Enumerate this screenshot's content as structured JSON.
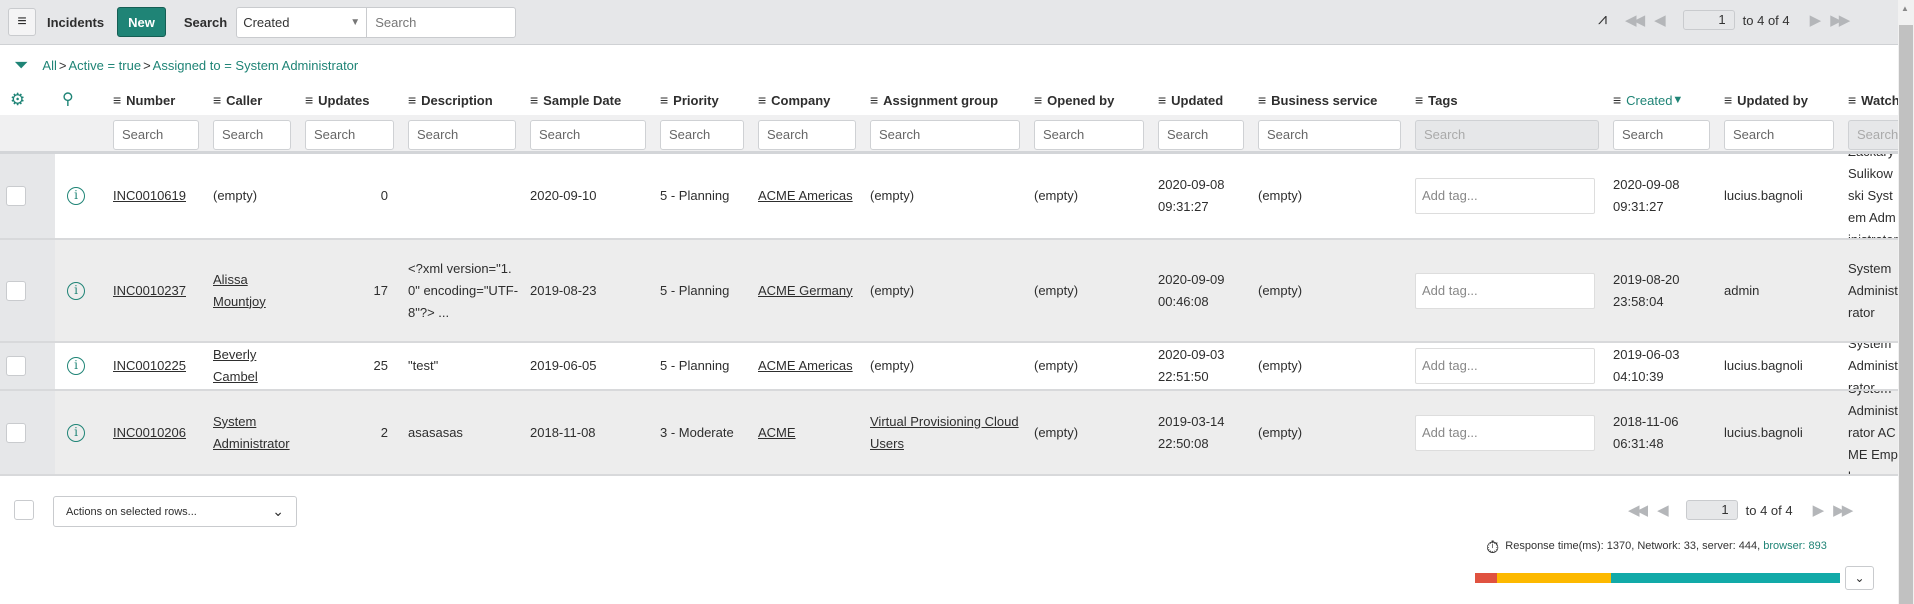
{
  "toolbar": {
    "title": "Incidents",
    "new_label": "New",
    "search_label": "Search",
    "search_field": "Created",
    "search_placeholder": "Search",
    "pager": {
      "page": "1",
      "range": "to 4 of 4"
    }
  },
  "breadcrumb": [
    "All",
    "Active = true",
    "Assigned to = System Administrator"
  ],
  "columns": [
    {
      "label": "Number",
      "search": "Search"
    },
    {
      "label": "Caller",
      "search": "Search"
    },
    {
      "label": "Updates",
      "search": "Search"
    },
    {
      "label": "Description",
      "search": "Search"
    },
    {
      "label": "Sample Date",
      "search": "Search"
    },
    {
      "label": "Priority",
      "search": "Search"
    },
    {
      "label": "Company",
      "search": "Search"
    },
    {
      "label": "Assignment group",
      "search": "Search"
    },
    {
      "label": "Opened by",
      "search": "Search"
    },
    {
      "label": "Updated",
      "search": "Search"
    },
    {
      "label": "Business service",
      "search": "Search"
    },
    {
      "label": "Tags",
      "search": "Search"
    },
    {
      "label": "Created",
      "search": "Search",
      "sorted": "desc"
    },
    {
      "label": "Updated by",
      "search": "Search"
    },
    {
      "label": "Watch list",
      "search": "Search"
    }
  ],
  "rows": [
    {
      "number": "INC0010619",
      "caller": "(empty)",
      "updates": "0",
      "description": "",
      "sample_date": "2020-09-10",
      "priority": "5 - Planning",
      "company": "ACME Americas",
      "assignment_group": "(empty)",
      "opened_by": "(empty)",
      "updated": "2020-09-08 09:31:27",
      "business_service": "(empty)",
      "tags": "Add tag...",
      "created": "2020-09-08 09:31:27",
      "updated_by": "lucius.bagnoli",
      "watch_list": "Zackary Sulikowski System Administrator"
    },
    {
      "number": "INC0010237",
      "caller": "Alissa Mountjoy",
      "updates": "17",
      "description": "<?xml version=\"1.0\" encoding=\"UTF-8\"?> ...",
      "sample_date": "2019-08-23",
      "priority": "5 - Planning",
      "company": "ACME Germany",
      "assignment_group": "(empty)",
      "opened_by": "(empty)",
      "updated": "2020-09-09 00:46:08",
      "business_service": "(empty)",
      "tags": "Add tag...",
      "created": "2019-08-20 23:58:04",
      "updated_by": "admin",
      "watch_list": "System Administrator"
    },
    {
      "number": "INC0010225",
      "caller": "Beverly Cambel",
      "updates": "25",
      "description": "\"test\"",
      "sample_date": "2019-06-05",
      "priority": "5 - Planning",
      "company": "ACME Americas",
      "assignment_group": "(empty)",
      "opened_by": "(empty)",
      "updated": "2020-09-03 22:51:50",
      "business_service": "(empty)",
      "tags": "Add tag...",
      "created": "2019-06-03 04:10:39",
      "updated_by": "lucius.bagnoli",
      "watch_list": "System Administrator"
    },
    {
      "number": "INC0010206",
      "caller": "System Administrator",
      "updates": "2",
      "description": "asasasas",
      "sample_date": "2018-11-08",
      "priority": "3 - Moderate",
      "company": "ACME",
      "assignment_group": "Virtual Provisioning Cloud Users",
      "opened_by": "(empty)",
      "updated": "2019-03-14 22:50:08",
      "business_service": "(empty)",
      "tags": "Add tag...",
      "created": "2018-11-06 06:31:48",
      "updated_by": "lucius.bagnoli",
      "watch_list": "System Administrator ACME Employee"
    }
  ],
  "footer": {
    "actions_label": "Actions on selected rows...",
    "pager": {
      "page": "1",
      "range": "to 4 of 4"
    },
    "response": {
      "prefix": "Response time(ms): 1370, Network: 33, server: 444,",
      "browser": "browser: 893"
    },
    "timing": {
      "network": 33,
      "server": 444,
      "browser": 893
    },
    "colors": {
      "network": "#e05240",
      "server": "#fdb900",
      "browser": "#12aaa8"
    }
  },
  "colors": {
    "accent": "#1f8476"
  }
}
